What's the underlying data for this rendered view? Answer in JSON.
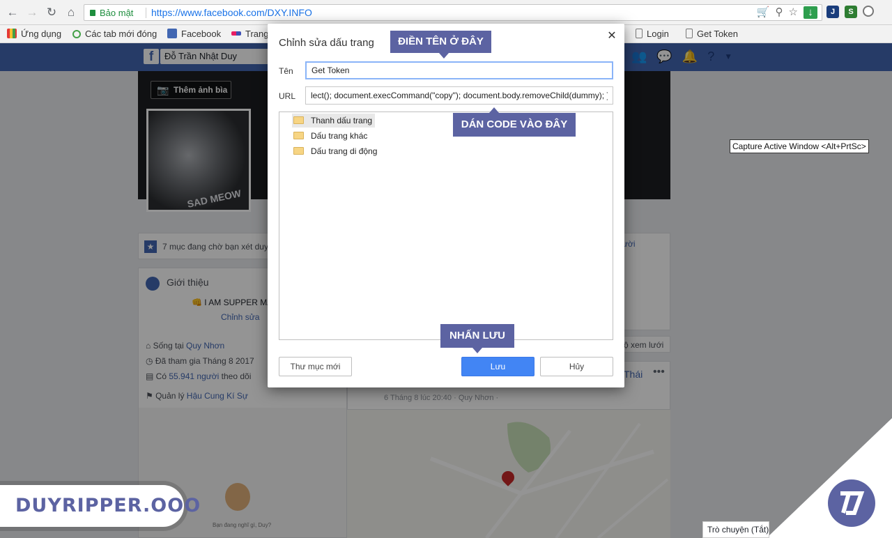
{
  "browser": {
    "secure_label": "Bảo mật",
    "url": "https://www.facebook.com/DXY.INFO",
    "bookmarks": [
      "Ứng dụng",
      "Các tab mới đóng",
      "Facebook",
      "Trang",
      "Login",
      "Get Token"
    ]
  },
  "facebook": {
    "profile_name": "Đỗ Trần Nhật Duy",
    "cover_button": "Thêm ảnh bìa",
    "avatar_caption": "SAD MEOW",
    "pending_review": "7 mục đang chờ bạn xét duyệt",
    "intro_title": "Giới thiệu",
    "intro_motto": "👊 I AM SUPPER MA",
    "edit_link": "Chỉnh sửa",
    "lives_in_prefix": "Sống tại",
    "lives_in_place": "Quy Nhơn",
    "joined": "Đã tham gia Tháng 8 2017",
    "followers_prefix": "Có",
    "followers_count": "55.941 người",
    "followers_suffix": "theo dõi",
    "manages_prefix": "Quản lý",
    "manages_page": "Hậu Cung Kí Sự",
    "post_time": "6 Tháng 8 lúc 20:40 · Quy Nhơn ·",
    "status_fragment": "Thái",
    "see_more": "ộ xem lưới",
    "right_fragment": "ười",
    "bottom_caption": "Bạn đang nghĩ gì, Duy?",
    "chat_tab": "Trò chuyện (Tắt)"
  },
  "tooltip": "Capture Active Window <Alt+PrtSc>",
  "dialog": {
    "title": "Chỉnh sửa dấu trang",
    "name_label": "Tên",
    "name_value": "Get Token",
    "url_label": "URL",
    "url_value": "lect(); document.execCommand(\"copy\"); document.body.removeChild(dummy); }",
    "folders": [
      "Thanh dấu trang",
      "Dấu trang khác",
      "Dấu trang di động"
    ],
    "new_folder_button": "Thư mục mới",
    "save_button": "Lưu",
    "cancel_button": "Hủy"
  },
  "callouts": {
    "name_hint": "ĐIỀN TÊN Ở ĐÂY",
    "code_hint": "DÁN CODE VÀO ĐÂY",
    "save_hint": "NHẤN LƯU"
  },
  "watermark": "DUYRIPPER.OOO",
  "colors": {
    "callout_bg": "#5c63a2",
    "facebook_blue": "#4267b2",
    "save_blue": "#4285f4"
  }
}
